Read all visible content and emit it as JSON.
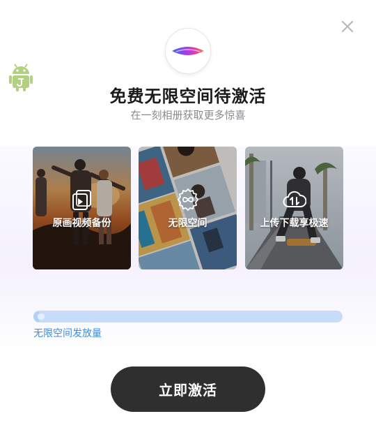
{
  "dialog": {
    "title": "免费无限空间待激活",
    "subtitle": "在一刻相册获取更多惊喜",
    "close_icon": "close-icon"
  },
  "features": [
    {
      "label": "原画视频备份",
      "icon": "video-play-icon"
    },
    {
      "label": "无限空间",
      "icon": "infinity-icon"
    },
    {
      "label": "上传下载享极速",
      "icon": "cloud-transfer-icon"
    }
  ],
  "progress": {
    "label": "无限空间发放量",
    "fraction": 0.02
  },
  "cta": {
    "label": "立即激活"
  },
  "colors": {
    "button_bg": "#2f2f2f",
    "progress_track": "#c7dcfb",
    "progress_label": "#3a8de0"
  }
}
